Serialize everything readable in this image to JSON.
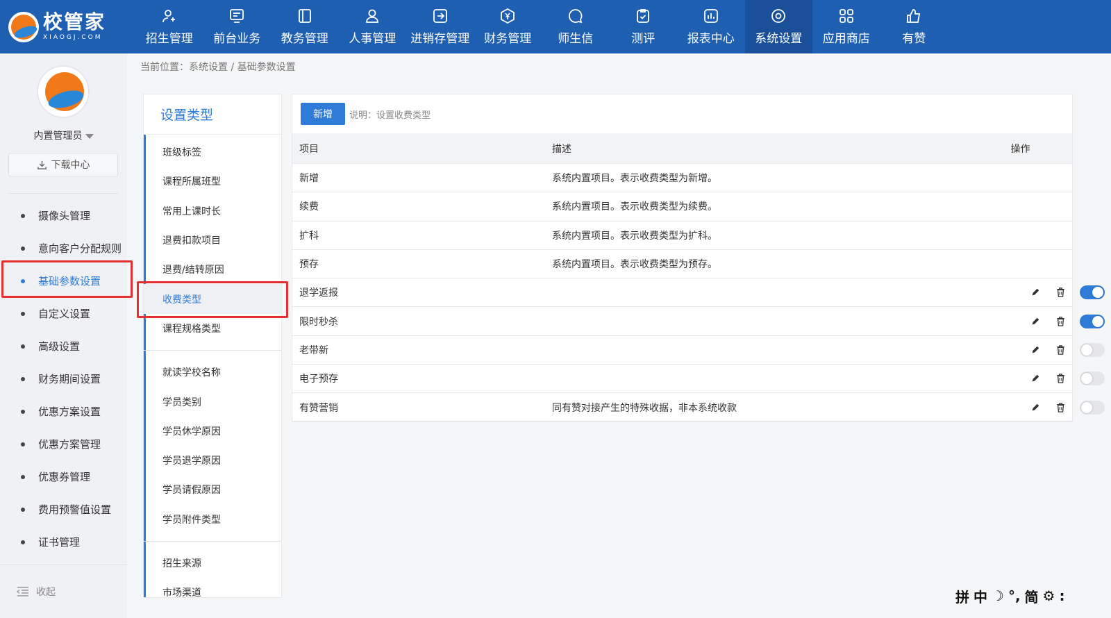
{
  "app": {
    "logo_cn": "校管家",
    "logo_en": "XIAOGJ.COM"
  },
  "nav": [
    {
      "label": "招生管理",
      "icon": "user-add-icon",
      "active": false
    },
    {
      "label": "前台业务",
      "icon": "monitor-icon",
      "active": false
    },
    {
      "label": "教务管理",
      "icon": "book-icon",
      "active": false
    },
    {
      "label": "人事管理",
      "icon": "person-icon",
      "active": false
    },
    {
      "label": "进销存管理",
      "icon": "inventory-icon",
      "active": false
    },
    {
      "label": "财务管理",
      "icon": "yen-icon",
      "active": false
    },
    {
      "label": "师生信",
      "icon": "chat-icon",
      "active": false
    },
    {
      "label": "测评",
      "icon": "clipboard-icon",
      "active": false
    },
    {
      "label": "报表中心",
      "icon": "chart-icon",
      "active": false
    },
    {
      "label": "系统设置",
      "icon": "settings-icon",
      "active": true
    },
    {
      "label": "应用商店",
      "icon": "grid-icon",
      "active": false
    },
    {
      "label": "有赞",
      "icon": "thumbs-up-icon",
      "active": false
    }
  ],
  "sidebar": {
    "user_name": "内置管理员",
    "download_label": "下载中心",
    "items": [
      {
        "label": "摄像头管理",
        "active": false
      },
      {
        "label": "意向客户分配规则",
        "active": false
      },
      {
        "label": "基础参数设置",
        "active": true
      },
      {
        "label": "自定义设置",
        "active": false
      },
      {
        "label": "高级设置",
        "active": false
      },
      {
        "label": "财务期间设置",
        "active": false
      },
      {
        "label": "优惠方案设置",
        "active": false
      },
      {
        "label": "优惠方案管理",
        "active": false
      },
      {
        "label": "优惠券管理",
        "active": false
      },
      {
        "label": "费用预警值设置",
        "active": false
      },
      {
        "label": "证书管理",
        "active": false
      }
    ],
    "collapse_label": "收起"
  },
  "breadcrumb": "当前位置：系统设置 / 基础参数设置",
  "settings_types": {
    "title": "设置类型",
    "groups": [
      [
        "班级标签",
        "课程所属班型",
        "常用上课时长",
        "退费扣款项目",
        "退费/结转原因",
        "收费类型",
        "课程规格类型"
      ],
      [
        "就读学校名称",
        "学员类别",
        "学员休学原因",
        "学员退学原因",
        "学员请假原因",
        "学员附件类型"
      ],
      [
        "招生来源",
        "市场渠道"
      ]
    ],
    "active": "收费类型"
  },
  "main": {
    "new_button": "新增",
    "note": "说明：设置收费类型",
    "columns": {
      "item": "项目",
      "desc": "描述",
      "op": "操作"
    },
    "rows": [
      {
        "item": "新增",
        "desc": "系统内置项目。表示收费类型为新增。",
        "ops": false,
        "enabled": null
      },
      {
        "item": "续费",
        "desc": "系统内置项目。表示收费类型为续费。",
        "ops": false,
        "enabled": null
      },
      {
        "item": "扩科",
        "desc": "系统内置项目。表示收费类型为扩科。",
        "ops": false,
        "enabled": null
      },
      {
        "item": "预存",
        "desc": "系统内置项目。表示收费类型为预存。",
        "ops": false,
        "enabled": null
      },
      {
        "item": "退学返报",
        "desc": "",
        "ops": true,
        "enabled": true
      },
      {
        "item": "限时秒杀",
        "desc": "",
        "ops": true,
        "enabled": true
      },
      {
        "item": "老带新",
        "desc": "",
        "ops": true,
        "enabled": false
      },
      {
        "item": "电子预存",
        "desc": "",
        "ops": true,
        "enabled": false
      },
      {
        "item": "有赞营销",
        "desc": "同有赞对接产生的特殊收据，非本系统收款",
        "ops": true,
        "enabled": false
      }
    ]
  },
  "ime": [
    "拼",
    "中",
    "☽",
    "°,",
    "简",
    "⚙",
    ":"
  ],
  "colors": {
    "primary": "#2f7bd8",
    "header": "#1f5fb2",
    "highlight_box": "#e53030"
  }
}
